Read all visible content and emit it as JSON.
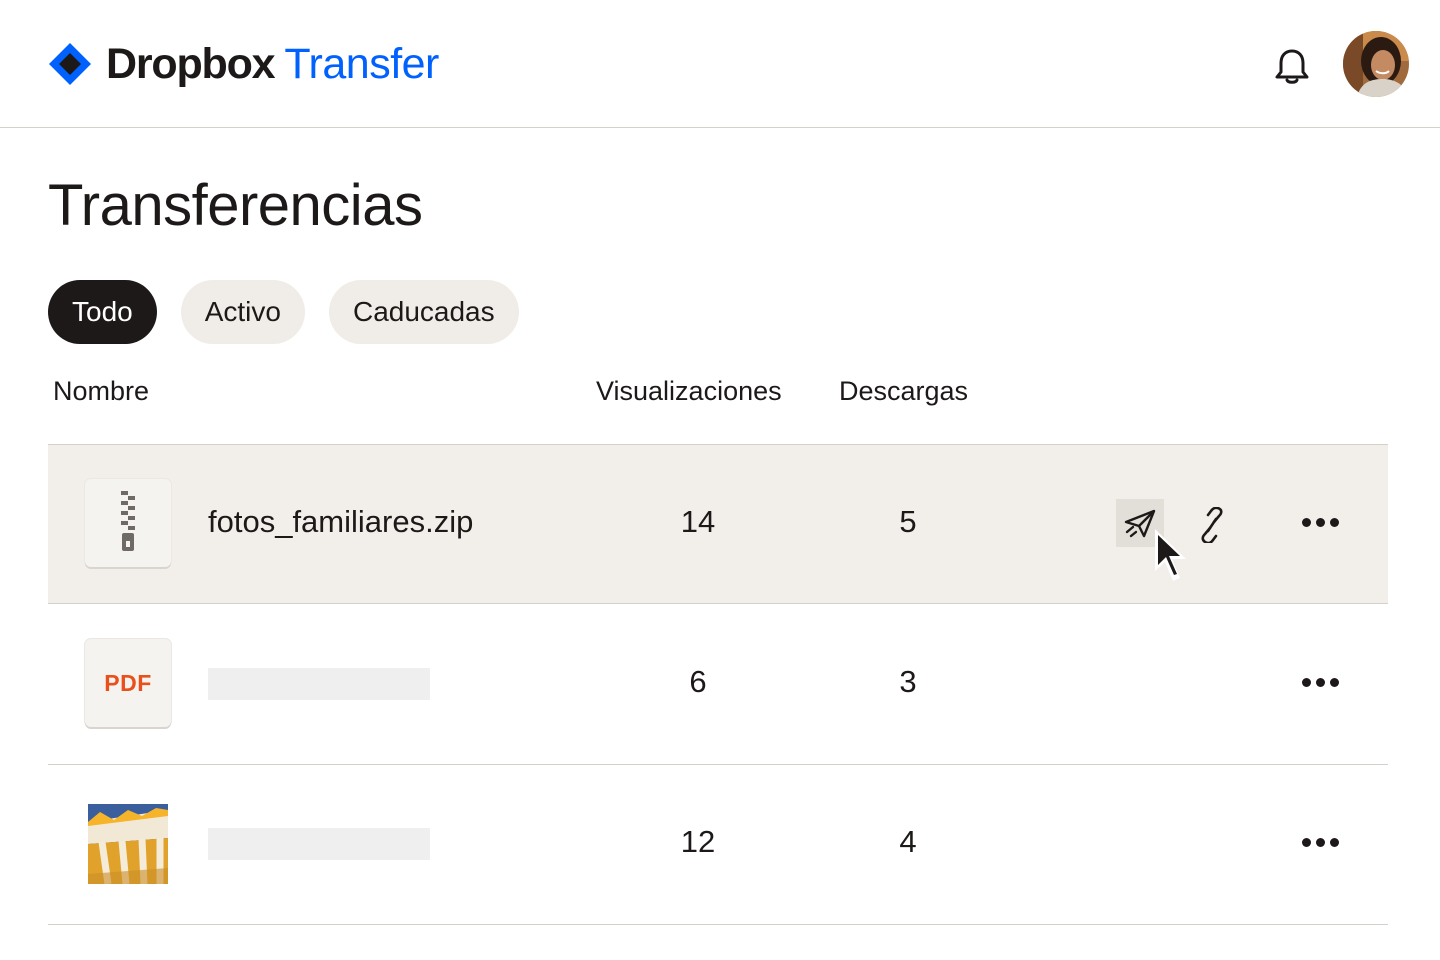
{
  "header": {
    "brand_primary": "Dropbox",
    "brand_secondary": "Transfer",
    "brand_color": "#0061fe",
    "notifications_icon": "bell-icon",
    "avatar_icon": "user-avatar"
  },
  "page": {
    "title": "Transferencias"
  },
  "filters": {
    "items": [
      {
        "label": "Todo",
        "active": true
      },
      {
        "label": "Activo",
        "active": false
      },
      {
        "label": "Caducadas",
        "active": false
      }
    ]
  },
  "table": {
    "columns": {
      "name": "Nombre",
      "views": "Visualizaciones",
      "downloads": "Descargas"
    },
    "rows": [
      {
        "file_name": "fotos_familiares.zip",
        "file_type": "zip",
        "icon": "zip-file-icon",
        "views": "14",
        "downloads": "5",
        "highlighted": true
      },
      {
        "file_name": "",
        "file_type": "pdf",
        "type_label": "PDF",
        "icon": "pdf-file-icon",
        "views": "6",
        "downloads": "3",
        "highlighted": false
      },
      {
        "file_name": "",
        "file_type": "image",
        "icon": "image-thumbnail",
        "views": "12",
        "downloads": "4",
        "highlighted": false
      }
    ],
    "row_actions": {
      "send_icon": "paper-plane-icon",
      "link_icon": "link-icon",
      "more_icon": "more-dots-icon"
    }
  },
  "colors": {
    "text": "#1e1919",
    "highlight_row": "#f2efeb",
    "chip_inactive": "#f0ede8",
    "chip_active": "#1e1919",
    "pdf_accent": "#e8501c"
  }
}
